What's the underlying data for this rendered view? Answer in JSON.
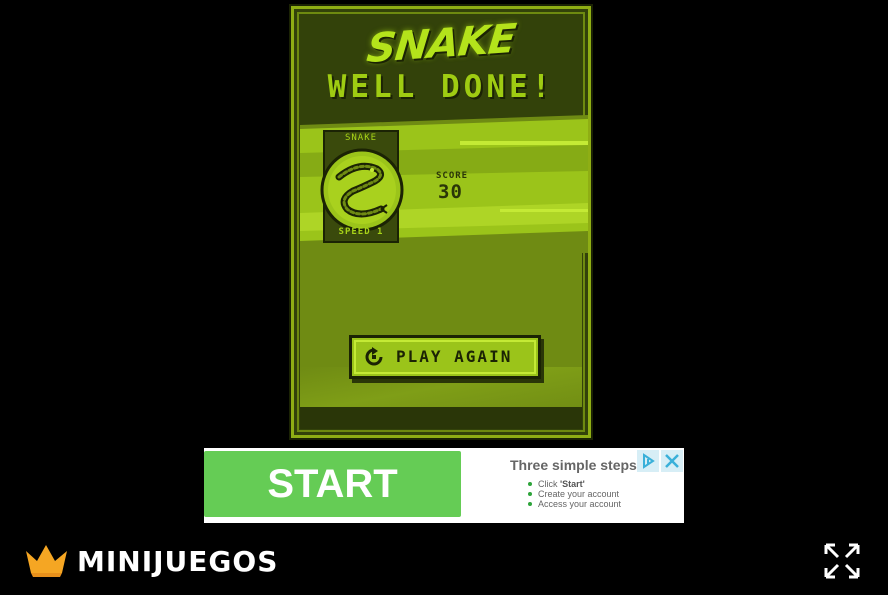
{
  "game": {
    "title": "SNAKE",
    "headline": "WELL DONE!",
    "card": {
      "title": "SNAKE",
      "speed": "SPEED 1"
    },
    "score_label": "SCORE",
    "score_value": "30",
    "play_again_label": "PLAY AGAIN",
    "colors": {
      "bright": "#b4e31b",
      "mid": "#8fae14",
      "dark": "#1b2304",
      "band": "#9bc41a"
    }
  },
  "ad": {
    "start_label": "START",
    "heading": "Three simple steps",
    "steps": [
      {
        "prefix": "Click ",
        "bold": "'Start'"
      },
      {
        "text": "Create your account"
      },
      {
        "text": "Access your account"
      }
    ],
    "accent": "#65cc55",
    "icons": {
      "choices": "adchoices-icon",
      "close": "close-icon"
    }
  },
  "footer": {
    "brand_name": "MINIJUEGOS",
    "crown_color": "#f5a623",
    "icons": {
      "brand": "crown-icon",
      "fullscreen": "fullscreen-icon"
    }
  }
}
